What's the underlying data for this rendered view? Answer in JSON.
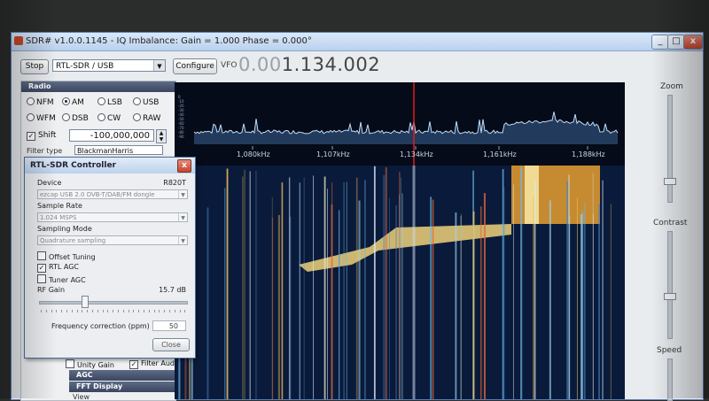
{
  "window": {
    "title": "SDR# v1.0.0.1145 - IQ Imbalance: Gain = 1.000 Phase = 0.000°",
    "min_glyph": "_",
    "max_glyph": "□",
    "close_glyph": "x"
  },
  "toolbar": {
    "stop_label": "Stop",
    "device_select": "RTL-SDR / USB",
    "configure_label": "Configure",
    "vfo_label": "VFO",
    "vfo_dim": "0.00",
    "vfo_main": "1.134.002"
  },
  "radio": {
    "header": "Radio",
    "modes": [
      "NFM",
      "AM",
      "LSB",
      "USB",
      "WFM",
      "DSB",
      "CW",
      "RAW"
    ],
    "selected_mode": "AM",
    "shift_label": "Shift",
    "shift_checked": true,
    "shift_value": "-100,000,000",
    "filter_label": "Filter type",
    "filter_value": "BlackmanHarris"
  },
  "bottom_panel": {
    "unity_gain_label": "Unity Gain",
    "filter_audio_label": "Filter Audio",
    "filter_audio_checked": true,
    "agc_header": "AGC",
    "fft_header": "FFT Display",
    "view_label": "View"
  },
  "spectrum": {
    "freq_labels": [
      "1,080kHz",
      "1,107kHz",
      "1,134kHz",
      "1,161kHz",
      "1,188kHz"
    ],
    "db_labels": [
      "0",
      "-10",
      "-20",
      "-30",
      "-40",
      "-50",
      "-60",
      "-70",
      "-80",
      "-90"
    ]
  },
  "right_panel": {
    "zoom_label": "Zoom",
    "contrast_label": "Contrast",
    "speed_label": "Speed"
  },
  "controller": {
    "title": "RTL-SDR Controller",
    "close_glyph": "x",
    "device_label": "Device",
    "tuner_name": "R820T",
    "device_value": "ezcap USB 2.0 DVB-T/DAB/FM dongle",
    "sample_rate_label": "Sample Rate",
    "sample_rate_value": "1.024 MSPS",
    "sampling_mode_label": "Sampling Mode",
    "sampling_mode_value": "Quadrature sampling",
    "offset_tuning_label": "Offset Tuning",
    "offset_tuning_checked": false,
    "rtl_agc_label": "RTL AGC",
    "rtl_agc_checked": true,
    "tuner_agc_label": "Tuner AGC",
    "tuner_agc_checked": false,
    "rf_gain_label": "RF Gain",
    "rf_gain_value": "15.7 dB",
    "rf_gain_level": 0.3,
    "freq_corr_label": "Frequency correction (ppm)",
    "freq_corr_value": "50",
    "close_label": "Close"
  },
  "colors": {
    "title_bar": "#c4d8f0",
    "spectrum_bg": "#050b18",
    "spectrum_line": "#d7ecff",
    "center_marker": "#e21b1b",
    "waterfall_bg": "#0a1a3a"
  }
}
